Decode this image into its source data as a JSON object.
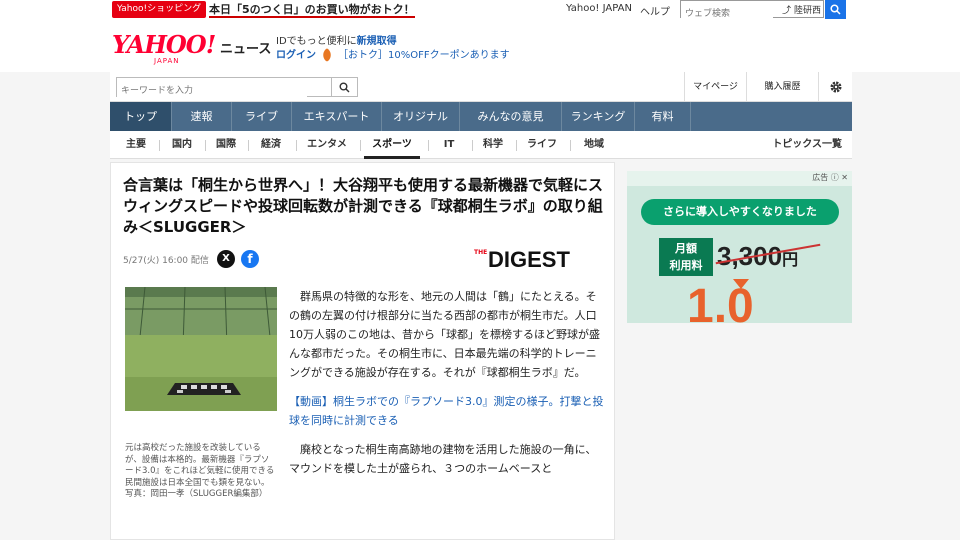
{
  "topbar": {
    "promo_badge": "Yahoo!ショッピング",
    "promo_text": "本日「5のつく日」のお買い物がおトク！",
    "yahoo_japan_link": "Yahoo! JAPAN",
    "help_link": "ヘルプ",
    "web_search_placeholder": "ウェブ検索",
    "web_search_rk": "⤴ 陸研西"
  },
  "header": {
    "logo": "YAHOO!",
    "logo_sub": "JAPAN",
    "logo_news": "ニュース",
    "id_prefix": "IDでもっと便利に",
    "id_link": "新規取得",
    "login": "ログイン",
    "coupon": "［おトク］10%OFFクーポンあります"
  },
  "search": {
    "placeholder": "キーワードを入力",
    "mypage": "マイページ",
    "history": "購入履歴"
  },
  "nav": {
    "items": [
      "トップ",
      "速報",
      "ライブ",
      "エキスパート",
      "オリジナル",
      "みんなの意見",
      "ランキング",
      "有料"
    ],
    "active": 0
  },
  "subnav": {
    "items": [
      "主要",
      "国内",
      "国際",
      "経済",
      "エンタメ",
      "スポーツ",
      "IT",
      "科学",
      "ライフ",
      "地域"
    ],
    "active_label": "スポーツ",
    "topics": "トピックス一覧"
  },
  "article": {
    "title": "合言葉は「桐生から世界へ」！大谷翔平も使用する最新機器で気軽にスウィングスピードや投球回転数が計測できる『球都桐生ラボ』の取り組み＜SLUGGER＞",
    "date": "5/27(火) 16:00 配信",
    "share_x": "X",
    "share_fb": "f",
    "source_the": "THE",
    "source": "DIGEST",
    "caption": "元は高校だった施設を改装しているが、設備は本格的。最新機器『ラプソード3.0』をこれほど気軽に使用できる民間施設は日本全国でも類を見ない。　写真：岡田一孝（SLUGGER編集部）",
    "para1": "群馬県の特徴的な形を、地元の人間は「鶴」にたとえる。その鶴の左翼の付け根部分に当たる西部の都市が桐生市だ。人口10万人弱のこの地は、昔から「球都」を標榜するほど野球が盛んな都市だった。その桐生市に、日本最先端の科学的トレーニングができる施設が存在する。それが『球都桐生ラボ』だ。",
    "link": "【動画】桐生ラボでの『ラプソード3.0』測定の様子。打撃と投球を同時に計測できる",
    "para2": "廃校となった桐生南高跡地の建物を活用した施設の一角に、マウンドを模した土が盛られ、３つのホームベースと"
  },
  "ad": {
    "label": "広告 ⓘ ✕",
    "banner": "さらに導入しやすくなりました",
    "box_line1": "月額",
    "box_line2": "利用料",
    "price": "3,300",
    "price_unit": "円",
    "big": "1.0"
  }
}
